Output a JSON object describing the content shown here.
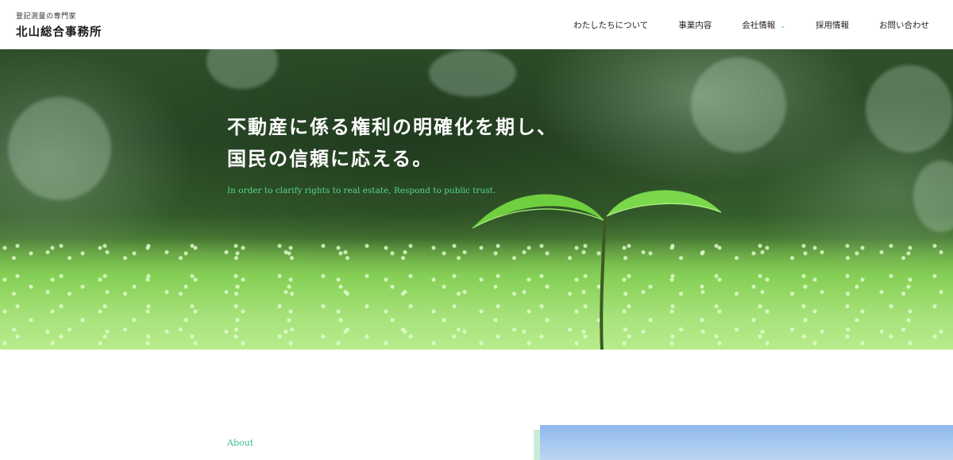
{
  "header": {
    "brand_sub": "登記測量の専門家",
    "brand_name": "北山総合事務所",
    "nav": [
      {
        "label": "わたしたちについて"
      },
      {
        "label": "事業内容"
      },
      {
        "label": "会社情報",
        "has_dropdown": true
      },
      {
        "label": "採用情報"
      },
      {
        "label": "お問い合わせ"
      }
    ]
  },
  "hero": {
    "title_line1": "不動産に係る権利の明確化を期し、",
    "title_line2": "国民の信頼に応える。",
    "subtitle": "In order to clarify rights to real estate, Respond to public trust."
  },
  "about": {
    "label": "About"
  },
  "colors": {
    "accent_green": "#3fbf8a",
    "hero_subtitle": "#56d68e",
    "text_dark": "#222222"
  },
  "icons": {
    "dropdown": "chevron-down-icon"
  }
}
